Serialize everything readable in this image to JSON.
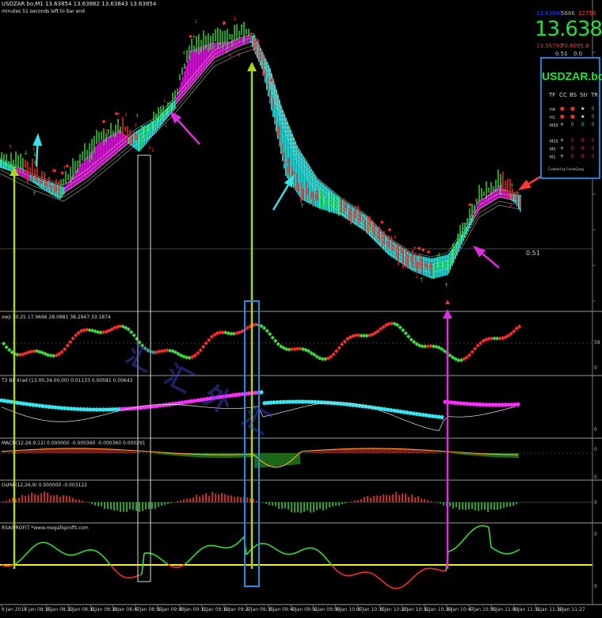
{
  "window": {
    "symbol_header": "USDZAR.bo,M1  13.63854  13.63862  13.63843  13.63854",
    "bar_timer": "minutes 51 seconds left to bar end"
  },
  "price_panel": {
    "line1_left": "13.63840",
    "line1_mid": "5686",
    "line1_right": "12750",
    "big_price": "13.63854",
    "line2_left": "13.56790",
    "line2_right": "70.6095.0",
    "line3_left": "0.51",
    "line3_right": "0.0",
    "colors": {
      "bid": "#1f45ff",
      "big": "#21e03a",
      "low": "#ff2a2a",
      "spread": "#ff3b3b"
    }
  },
  "dashboard": {
    "title": "USDZAR.bo",
    "headers": [
      "TF",
      "CC",
      "BS",
      "Str",
      "TR"
    ],
    "rows": [
      {
        "tf": "H4",
        "cells": [
          {
            "sym": "■",
            "color": "#ff2a2a"
          },
          {
            "sym": "■",
            "color": "#ff2a2a"
          },
          {
            "sym": "★",
            "color": "#ffffff"
          },
          {
            "sym": "0",
            "color": "#2fe03a"
          }
        ]
      },
      {
        "tf": "H1",
        "cells": [
          {
            "sym": "■",
            "color": "#ff2a2a"
          },
          {
            "sym": "■",
            "color": "#ff2a2a"
          },
          {
            "sym": "★",
            "color": "#ffffff"
          },
          {
            "sym": "0",
            "color": "#2fe03a"
          }
        ]
      },
      {
        "tf": "M30",
        "cells": [
          {
            "sym": "+",
            "color": "#ffffff"
          },
          {
            "sym": "0",
            "color": "#2fe03a"
          },
          {
            "sym": "0",
            "color": "#2fe03a"
          },
          {
            "sym": "0",
            "color": "#2fe03a"
          }
        ]
      },
      {
        "tf": "M15",
        "cells": [
          {
            "sym": "+",
            "color": "#ffffff"
          },
          {
            "sym": "0",
            "color": "#ff2a2a"
          },
          {
            "sym": "0",
            "color": "#ff2a2a"
          },
          {
            "sym": "0",
            "color": "#ff2a2a"
          }
        ]
      },
      {
        "tf": "M5",
        "cells": [
          {
            "sym": "+",
            "color": "#ffffff"
          },
          {
            "sym": "0",
            "color": "#ff2a2a"
          },
          {
            "sym": "0",
            "color": "#ff2a2a"
          },
          {
            "sym": "0",
            "color": "#ff2a2a"
          }
        ]
      },
      {
        "tf": "M1",
        "cells": [
          {
            "sym": "+",
            "color": "#ffffff"
          },
          {
            "sym": "0",
            "color": "#ff2a2a"
          },
          {
            "sym": "0",
            "color": "#ff2a2a"
          },
          {
            "sym": "0",
            "color": "#ff2a2a"
          }
        ]
      }
    ],
    "credit": "Created by ForexGang"
  },
  "main_chart": {
    "last_price_label": "0.51",
    "colors": {
      "band_up": "#d21bd2",
      "band_down": "#2fe0e0",
      "bull": "#35e03a",
      "bear": "#ff2a2a"
    }
  },
  "panes": [
    {
      "id": "stoch",
      "title": "xwji 10.25  17.9666 28.0881 38.2947 33.1874",
      "axis": [
        "58",
        "0"
      ]
    },
    {
      "id": "trend",
      "title": "T3 Bil Xrad (13.00,34.00,00) 0.01133 0.00581 0.00643",
      "axis": [
        "",
        "0"
      ]
    },
    {
      "id": "macd",
      "title": "MACD(12,26,9,12) 0.000000 -0.000360 -0.000360 0.000291",
      "axis": [
        "0",
        "0"
      ]
    },
    {
      "id": "osma",
      "title": "OsMA(12,26,9) 0.000000 -0.003122",
      "axis": [
        "0"
      ]
    },
    {
      "id": "rsi",
      "title": "RSAIPROFIT  *www.megafxprofit.com",
      "axis": [
        "0",
        "0"
      ]
    }
  ],
  "x_axis": {
    "labels": [
      "6 Jan 2017",
      "6 Jan 08:15",
      "6 Jan 08:23",
      "6 Jan 08:31",
      "6 Jan 08:39",
      "6 Jan 08:47",
      "6 Jan 08:55",
      "6 Jan 09:03",
      "6 Jan 09:11",
      "6 Jan 09:19",
      "6 Jan 09:27",
      "6 Jan 09:35",
      "6 Jan 09:43",
      "6 Jan 09:51",
      "6 Jan 09:59",
      "6 Jan 10:07",
      "6 Jan 10:15",
      "6 Jan 10:23",
      "6 Jan 10:31",
      "6 Jan 10:39",
      "6 Jan 10:47",
      "6 Jan 10:55",
      "6 Jan 11:03",
      "6 Jan 11:11",
      "6 Jan 11:19",
      "6 Jan 11:27"
    ]
  },
  "watermark": "汇  汇  外  汇"
}
